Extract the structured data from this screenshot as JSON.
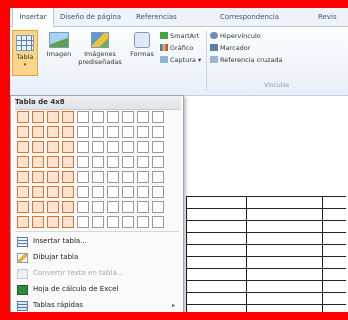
{
  "tabs": [
    "Insertar",
    "Diseño de página",
    "Referencias",
    "Correspondencia",
    "Revis"
  ],
  "active_tab": 0,
  "ribbon": {
    "tabla": "Tabla",
    "imagen": "Imagen",
    "imagenes_line1": "Imágenes",
    "imagenes_line2": "prediseñadas",
    "formas": "Formas",
    "smartart": "SmartArt",
    "grafico": "Gráfico",
    "captura": "Captura ▾",
    "hipervinculo": "Hipervínculo",
    "marcador": "Marcador",
    "referencia": "Referencia cruzada",
    "group_vinculos": "Vínculos"
  },
  "dropdown": {
    "title": "Tabla de 4x8",
    "grid_cols": 10,
    "grid_rows": 8,
    "selected_cols": 4,
    "selected_rows": 8,
    "items": [
      {
        "label": "Insertar tabla...",
        "icon": "insert-table-icon",
        "disabled": false,
        "arrow": false
      },
      {
        "label": "Dibujar tabla",
        "icon": "pencil-icon",
        "disabled": false,
        "arrow": false
      },
      {
        "label": "Convertir texto en tabla...",
        "icon": "convert-text-icon",
        "disabled": true,
        "arrow": false
      },
      {
        "label": "Hoja de cálculo de Excel",
        "icon": "excel-icon",
        "disabled": false,
        "arrow": false
      },
      {
        "label": "Tablas rápidas",
        "icon": "quick-tables-icon",
        "disabled": false,
        "arrow": true
      }
    ]
  },
  "colors": {
    "frame": "#ff0000",
    "highlight_border": "#e8702a",
    "highlight_fill": "#fce3d2",
    "selected_button": "#fbd68a"
  }
}
